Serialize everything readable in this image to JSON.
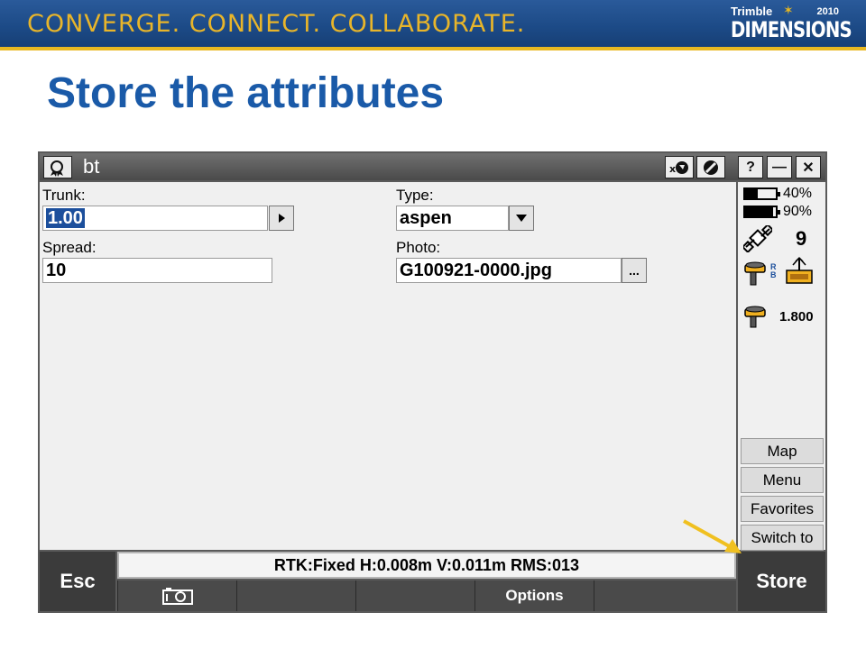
{
  "banner": {
    "tagline": "CONVERGE. CONNECT. COLLABORATE.",
    "logo_brand": "Trimble",
    "logo_year": "2010",
    "logo_name": "DIMENSIONS"
  },
  "slide_title": "Store the attributes",
  "window": {
    "title": "bt",
    "icons": [
      "ribbon-icon",
      "close-map-icon",
      "no-entry-icon"
    ],
    "help_label": "?",
    "minimize_label": "—",
    "close_label": "✕"
  },
  "form": {
    "trunk": {
      "label": "Trunk:",
      "value": "1.00"
    },
    "spread": {
      "label": "Spread:",
      "value": "10"
    },
    "type": {
      "label": "Type:",
      "value": "aspen"
    },
    "photo": {
      "label": "Photo:",
      "value": "G100921-0000.jpg",
      "browse_label": "..."
    }
  },
  "status_panel": {
    "battery1": "40%",
    "battery2": "90%",
    "battery1_level": 0.4,
    "battery2_level": 0.9,
    "satellites": "9",
    "antenna_height": "1.800",
    "rover_label": "R B"
  },
  "side_buttons": [
    "Map",
    "Menu",
    "Favorites",
    "Switch to"
  ],
  "bottom": {
    "esc_label": "Esc",
    "status_text": "RTK:Fixed H:0.008m V:0.011m RMS:013",
    "softkeys": [
      "",
      "",
      "",
      "Options",
      ""
    ],
    "store_label": "Store"
  },
  "colors": {
    "accent_blue": "#1a5aa8",
    "banner_gold": "#e8b52a",
    "arrow": "#f0c020"
  }
}
